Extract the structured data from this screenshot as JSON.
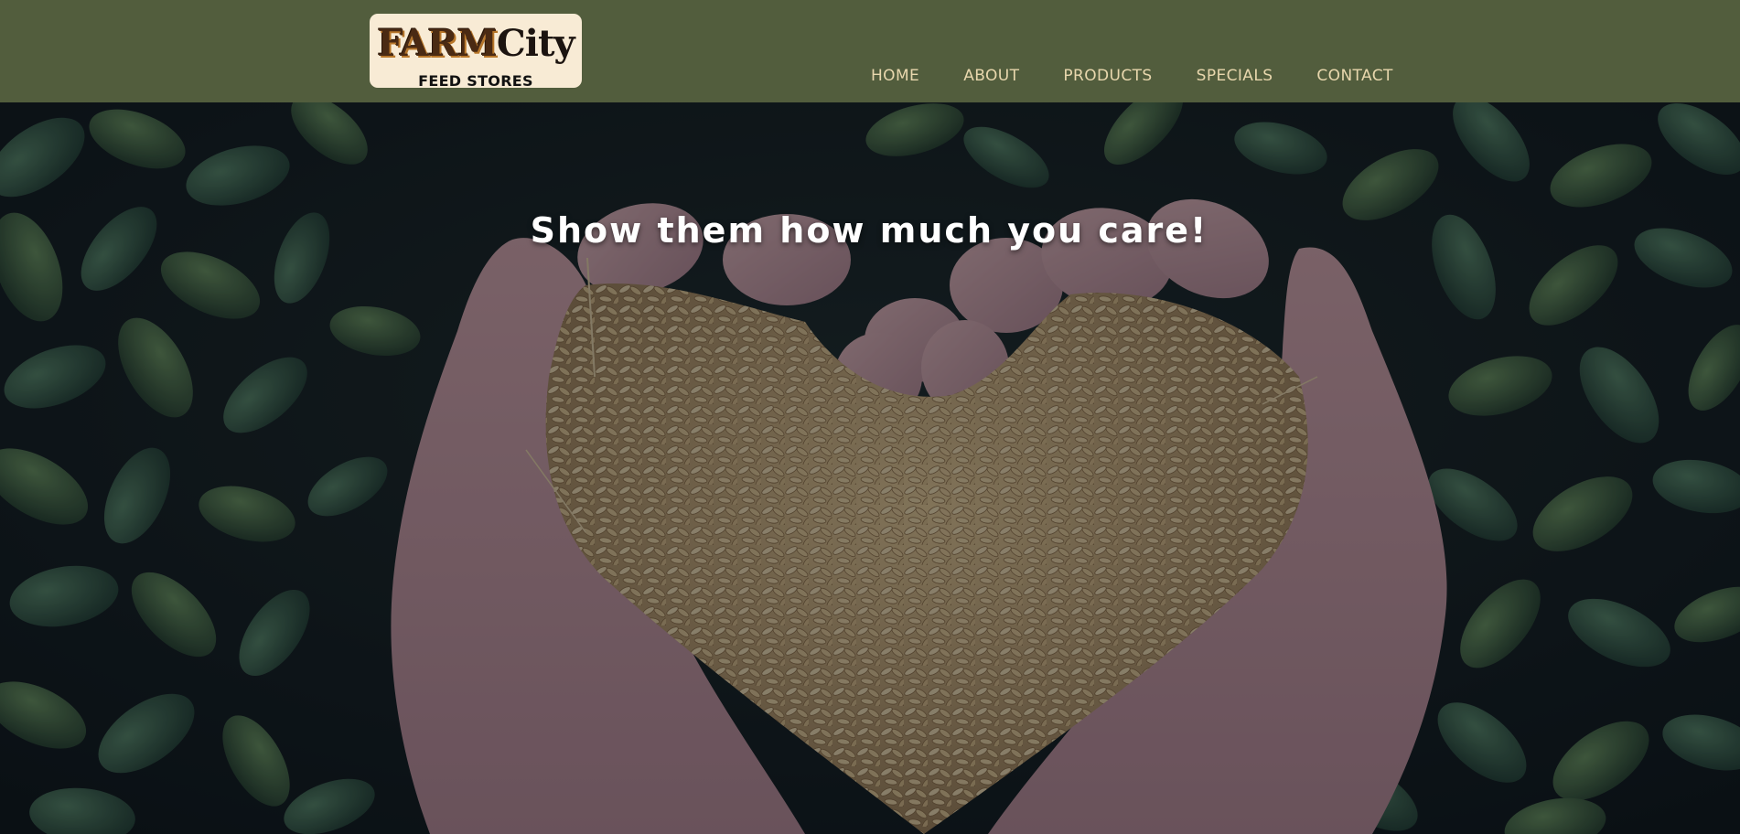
{
  "logo": {
    "main_left": "FARM",
    "main_right": "City",
    "subtitle": "FEED STORES"
  },
  "nav": {
    "items": [
      {
        "label": "HOME"
      },
      {
        "label": "ABOUT"
      },
      {
        "label": "PRODUCTS"
      },
      {
        "label": "SPECIALS"
      },
      {
        "label": "CONTACT"
      }
    ]
  },
  "hero": {
    "title": "Show them how much you care!",
    "image_subject": "hands cupping grain in heart shape over green leaves"
  },
  "colors": {
    "header_bg": "#525d3d",
    "nav_text": "#e8d7ad",
    "logo_bg": "#f8ebd5",
    "hero_title": "#ffffff"
  }
}
